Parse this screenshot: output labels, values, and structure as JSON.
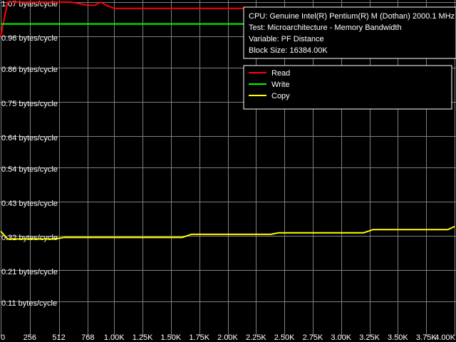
{
  "chart_data": {
    "type": "line",
    "grid": true,
    "legend_position": "top-right",
    "xlim": [
      0,
      4000
    ],
    "ylim": [
      0,
      1.07
    ],
    "x_ticks": [
      {
        "value": 0,
        "label": "0"
      },
      {
        "value": 256,
        "label": "256"
      },
      {
        "value": 512,
        "label": "512"
      },
      {
        "value": 768,
        "label": "768"
      },
      {
        "value": 1000,
        "label": "1.00K"
      },
      {
        "value": 1250,
        "label": "1.25K"
      },
      {
        "value": 1500,
        "label": "1.50K"
      },
      {
        "value": 1750,
        "label": "1.75K"
      },
      {
        "value": 2000,
        "label": "2.00K"
      },
      {
        "value": 2250,
        "label": "2.25K"
      },
      {
        "value": 2500,
        "label": "2.50K"
      },
      {
        "value": 2750,
        "label": "2.75K"
      },
      {
        "value": 3000,
        "label": "3.00K"
      },
      {
        "value": 3250,
        "label": "3.25K"
      },
      {
        "value": 3500,
        "label": "3.50K"
      },
      {
        "value": 3750,
        "label": "3.75K"
      },
      {
        "value": 4000,
        "label": "4.00K"
      }
    ],
    "y_ticks": [
      {
        "value": 1.07,
        "label": "1.07 bytes/cycle"
      },
      {
        "value": 0.96,
        "label": "0.96 bytes/cycle"
      },
      {
        "value": 0.86,
        "label": "0.86 bytes/cycle"
      },
      {
        "value": 0.75,
        "label": "0.75 bytes/cycle"
      },
      {
        "value": 0.64,
        "label": "0.64 bytes/cycle"
      },
      {
        "value": 0.54,
        "label": "0.54 bytes/cycle"
      },
      {
        "value": 0.43,
        "label": "0.43 bytes/cycle"
      },
      {
        "value": 0.32,
        "label": "0.32 bytes/cycle"
      },
      {
        "value": 0.21,
        "label": "0.21 bytes/cycle"
      },
      {
        "value": 0.11,
        "label": "0.11 bytes/cycle"
      }
    ],
    "info_lines": [
      "CPU: Genuine Intel(R) Pentium(R) M (Dothan) 2000.1 MHz",
      "Test: Microarchitecture - Memory Bandwidth",
      "Variable: PF Distance",
      "Block Size: 16384.00K"
    ],
    "series": [
      {
        "name": "Read",
        "color": "#ff0000",
        "x": [
          0,
          60,
          100,
          420,
          620,
          770,
          830,
          880,
          930,
          1000,
          4000
        ],
        "y": [
          0.96,
          1.07,
          1.07,
          1.07,
          1.07,
          1.06,
          1.06,
          1.07,
          1.06,
          1.05,
          1.05
        ]
      },
      {
        "name": "Write",
        "color": "#00ff00",
        "x": [
          0,
          4000
        ],
        "y": [
          1.0,
          1.0
        ]
      },
      {
        "name": "Copy",
        "color": "#ffff00",
        "x": [
          0,
          60,
          480,
          560,
          1600,
          1680,
          2380,
          2450,
          3200,
          3280,
          3940,
          4000
        ],
        "y": [
          0.335,
          0.31,
          0.31,
          0.315,
          0.315,
          0.325,
          0.325,
          0.33,
          0.33,
          0.34,
          0.34,
          0.35
        ]
      }
    ]
  }
}
